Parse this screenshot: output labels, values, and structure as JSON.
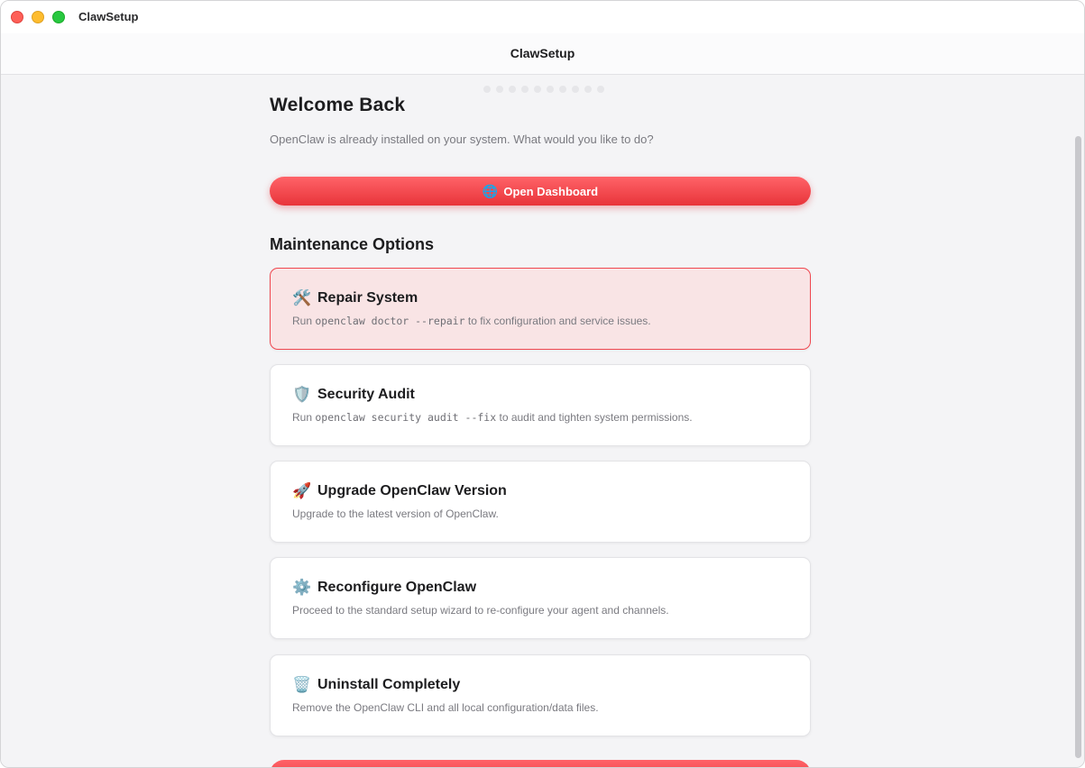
{
  "window": {
    "app_title": "ClawSetup"
  },
  "header": {
    "title": "ClawSetup"
  },
  "progress": {
    "steps": 10
  },
  "welcome": {
    "title": "Welcome Back",
    "subtitle": "OpenClaw is already installed on your system. What would you like to do?"
  },
  "primary_action": {
    "icon": "globe-icon",
    "glyph": "🌐",
    "label": "Open Dashboard"
  },
  "maintenance": {
    "title": "Maintenance Options",
    "options": [
      {
        "icon": "tools-icon",
        "glyph": "🛠️",
        "title": "Repair System",
        "desc_prefix": "Run ",
        "desc_code": "openclaw doctor --repair",
        "desc_suffix": " to fix configuration and service issues.",
        "selected": true
      },
      {
        "icon": "shield-icon",
        "glyph": "🛡️",
        "title": "Security Audit",
        "desc_prefix": "Run ",
        "desc_code": "openclaw security audit --fix",
        "desc_suffix": " to audit and tighten system permissions.",
        "selected": false
      },
      {
        "icon": "rocket-icon",
        "glyph": "🚀",
        "title": "Upgrade OpenClaw Version",
        "desc": "Upgrade to the latest version of OpenClaw.",
        "selected": false
      },
      {
        "icon": "gear-icon",
        "glyph": "⚙️",
        "title": "Reconfigure OpenClaw",
        "desc": "Proceed to the standard setup wizard to re-configure your agent and channels.",
        "selected": false
      },
      {
        "icon": "trash-icon",
        "glyph": "🗑️",
        "title": "Uninstall Completely",
        "desc": "Remove the OpenClaw CLI and all local configuration/data files.",
        "selected": false
      }
    ]
  },
  "colors": {
    "accent": "#e8343a",
    "selected_bg": "#f9e4e5",
    "selected_border": "#f0474f"
  }
}
